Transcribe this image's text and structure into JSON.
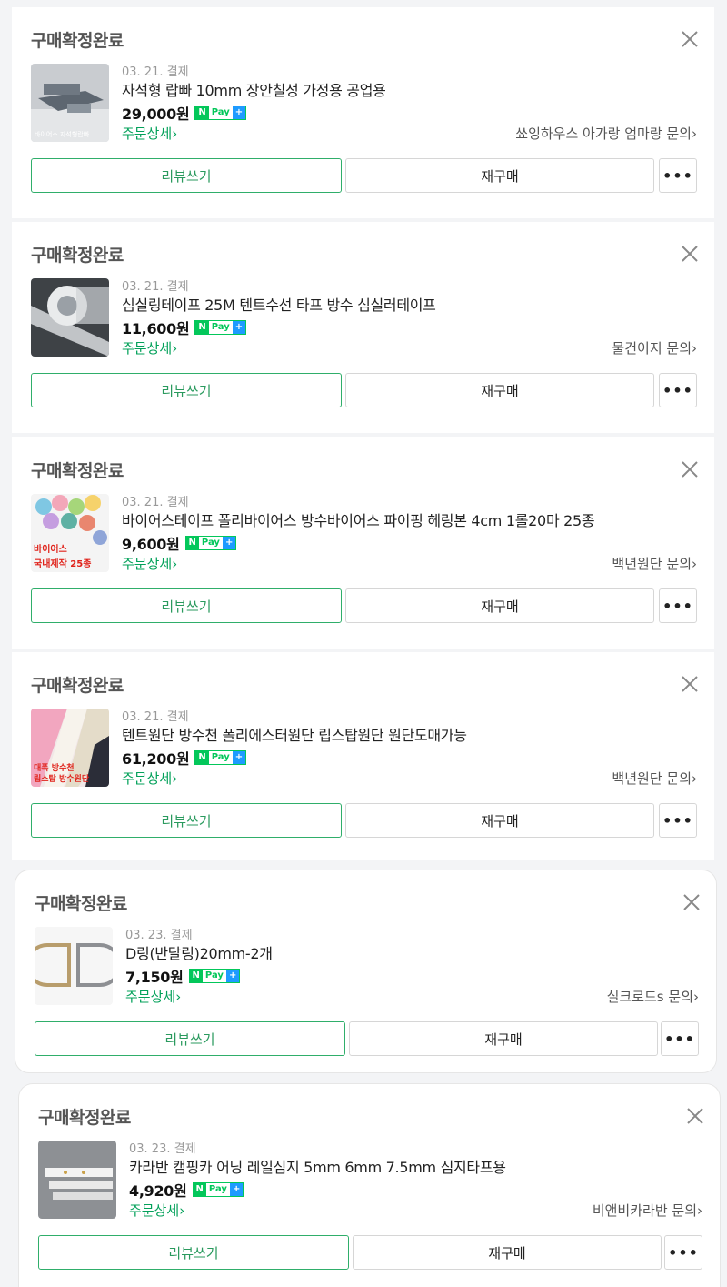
{
  "orders": [
    {
      "status": "구매확정완료",
      "date": "03. 21. 결제",
      "name": "자석형 랍빠 10mm 장안칠성 가정용 공업용",
      "price": "29,000원",
      "detail_link": "주문상세›",
      "inquiry": "쑈잉하우스 아가랑 엄마랑 문의›",
      "review_label": "리뷰쓰기",
      "rebuy_label": "재구매",
      "more_label": "•••",
      "thumb_caption": "바이어스 자석형랍빠"
    },
    {
      "status": "구매확정완료",
      "date": "03. 21. 결제",
      "name": "심실링테이프 25M 텐트수선 타프 방수 심실러테이프",
      "price": "11,600원",
      "detail_link": "주문상세›",
      "inquiry": "물건이지 문의›",
      "review_label": "리뷰쓰기",
      "rebuy_label": "재구매",
      "more_label": "•••"
    },
    {
      "status": "구매확정완료",
      "date": "03. 21. 결제",
      "name": "바이어스테이프 폴리바이어스 방수바이어스 파이핑 헤링본 4cm 1롤20마 25종",
      "price": "9,600원",
      "detail_link": "주문상세›",
      "inquiry": "백년원단 문의›",
      "review_label": "리뷰쓰기",
      "rebuy_label": "재구매",
      "more_label": "•••",
      "thumb_caption_1": "바이어스",
      "thumb_caption_2": "국내제작 25종"
    },
    {
      "status": "구매확정완료",
      "date": "03. 21. 결제",
      "name": "텐트원단 방수천 폴리에스터원단 립스탑원단 원단도매가능",
      "price": "61,200원",
      "detail_link": "주문상세›",
      "inquiry": "백년원단 문의›",
      "review_label": "리뷰쓰기",
      "rebuy_label": "재구매",
      "more_label": "•••",
      "thumb_caption_1": "대폭 방수천",
      "thumb_caption_2": "립스탑 방수원단"
    },
    {
      "status": "구매확정완료",
      "date": "03. 23. 결제",
      "name": "D링(반달링)20mm-2개",
      "price": "7,150원",
      "detail_link": "주문상세›",
      "inquiry": "실크로드s 문의›",
      "review_label": "리뷰쓰기",
      "rebuy_label": "재구매",
      "more_label": "•••"
    },
    {
      "status": "구매확정완료",
      "date": "03. 23. 결제",
      "name": "카라반 캠핑카 어닝 레일심지 5mm 6mm 7.5mm 심지타프용",
      "price": "4,920원",
      "detail_link": "주문상세›",
      "inquiry": "비앤비카라반 문의›",
      "review_label": "리뷰쓰기",
      "rebuy_label": "재구매",
      "more_label": "•••"
    }
  ],
  "npay": {
    "n": "N",
    "pay": "Pay",
    "plus": "+"
  },
  "colors": {
    "accent_green": "#03c75a",
    "link_green": "#03a15a",
    "npay_blue": "#1e9bff"
  },
  "icons": {
    "close": "close-icon"
  }
}
